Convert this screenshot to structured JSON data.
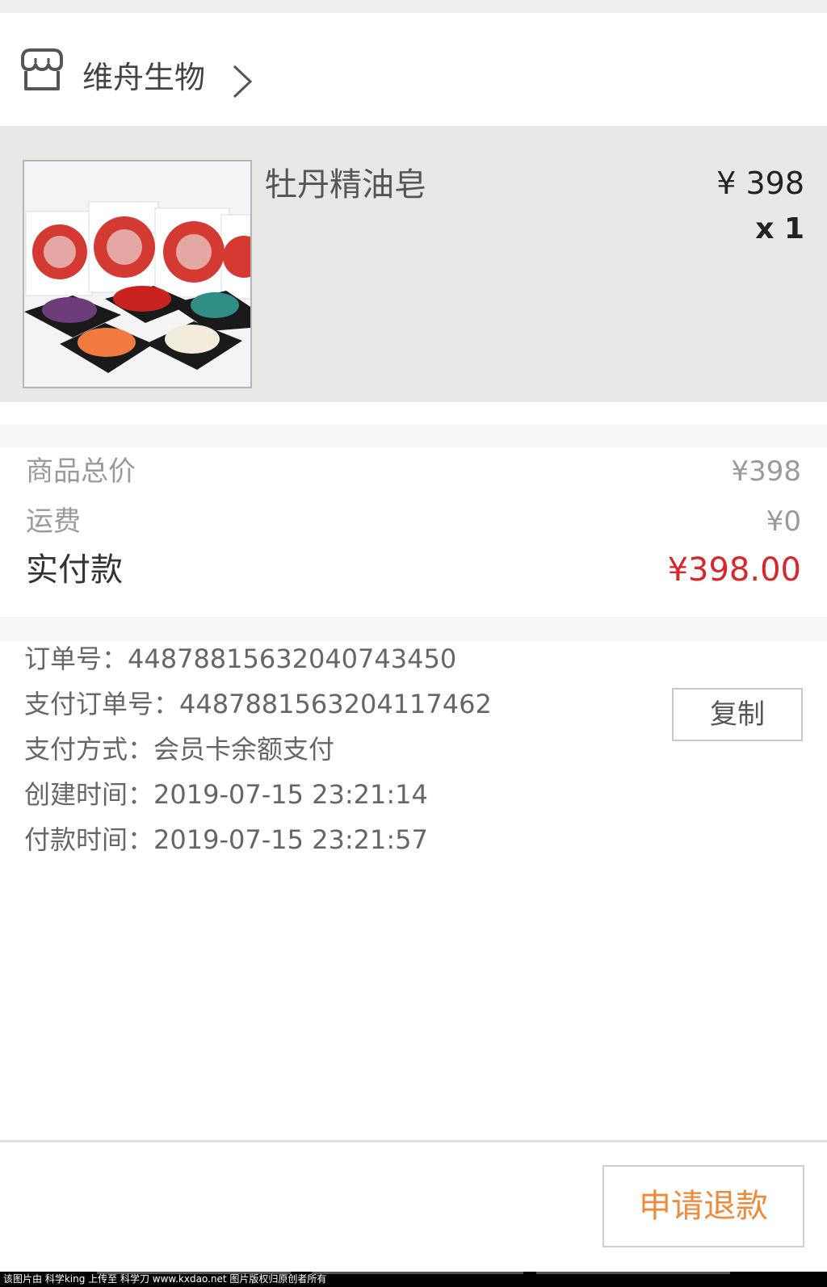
{
  "store": {
    "name": "维舟生物",
    "icon": "shop-icon",
    "chevron_icon": "chevron-right-icon"
  },
  "product": {
    "name": "牡丹精油皂",
    "price": "¥ 398",
    "quantity": "x 1",
    "image_icon": "product-image"
  },
  "summary": {
    "goods_total_label": "商品总价",
    "goods_total_value": "¥398",
    "shipping_label": "运费",
    "shipping_value": "¥0",
    "paid_label": "实付款",
    "paid_value": "¥398.00",
    "accent_color": "#d9262c"
  },
  "order_info": {
    "order_no": "订单号：448788156320407434​50",
    "pay_order_no": "支付订单号：4487881563204117462",
    "pay_method": "支付方式：会员卡余额支付",
    "created_time": "创建时间：2019-07-15 23:21:14",
    "paid_time": "付款时间：2019-07-15 23:21:57",
    "copy_label": "复制"
  },
  "actions": {
    "refund_label": "申请退款",
    "refund_color": "#ee8a3a"
  },
  "footer": {
    "text": "该图片由 科学king 上传至 科学刀 www.kxdao.net 图片版权归原创者所有"
  }
}
